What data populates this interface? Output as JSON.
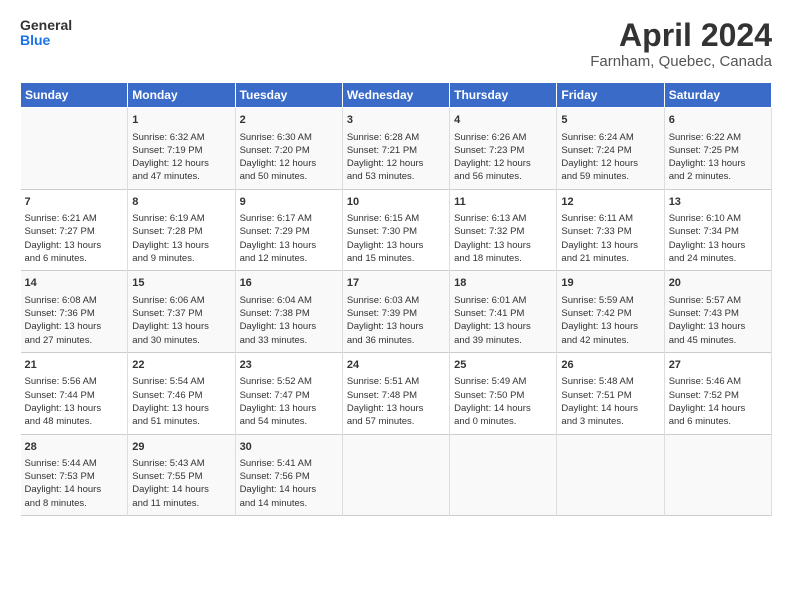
{
  "header": {
    "logo_line1": "General",
    "logo_line2": "Blue",
    "title": "April 2024",
    "subtitle": "Farnham, Quebec, Canada"
  },
  "days_of_week": [
    "Sunday",
    "Monday",
    "Tuesday",
    "Wednesday",
    "Thursday",
    "Friday",
    "Saturday"
  ],
  "weeks": [
    [
      {
        "day": "",
        "content": ""
      },
      {
        "day": "1",
        "content": "Sunrise: 6:32 AM\nSunset: 7:19 PM\nDaylight: 12 hours\nand 47 minutes."
      },
      {
        "day": "2",
        "content": "Sunrise: 6:30 AM\nSunset: 7:20 PM\nDaylight: 12 hours\nand 50 minutes."
      },
      {
        "day": "3",
        "content": "Sunrise: 6:28 AM\nSunset: 7:21 PM\nDaylight: 12 hours\nand 53 minutes."
      },
      {
        "day": "4",
        "content": "Sunrise: 6:26 AM\nSunset: 7:23 PM\nDaylight: 12 hours\nand 56 minutes."
      },
      {
        "day": "5",
        "content": "Sunrise: 6:24 AM\nSunset: 7:24 PM\nDaylight: 12 hours\nand 59 minutes."
      },
      {
        "day": "6",
        "content": "Sunrise: 6:22 AM\nSunset: 7:25 PM\nDaylight: 13 hours\nand 2 minutes."
      }
    ],
    [
      {
        "day": "7",
        "content": "Sunrise: 6:21 AM\nSunset: 7:27 PM\nDaylight: 13 hours\nand 6 minutes."
      },
      {
        "day": "8",
        "content": "Sunrise: 6:19 AM\nSunset: 7:28 PM\nDaylight: 13 hours\nand 9 minutes."
      },
      {
        "day": "9",
        "content": "Sunrise: 6:17 AM\nSunset: 7:29 PM\nDaylight: 13 hours\nand 12 minutes."
      },
      {
        "day": "10",
        "content": "Sunrise: 6:15 AM\nSunset: 7:30 PM\nDaylight: 13 hours\nand 15 minutes."
      },
      {
        "day": "11",
        "content": "Sunrise: 6:13 AM\nSunset: 7:32 PM\nDaylight: 13 hours\nand 18 minutes."
      },
      {
        "day": "12",
        "content": "Sunrise: 6:11 AM\nSunset: 7:33 PM\nDaylight: 13 hours\nand 21 minutes."
      },
      {
        "day": "13",
        "content": "Sunrise: 6:10 AM\nSunset: 7:34 PM\nDaylight: 13 hours\nand 24 minutes."
      }
    ],
    [
      {
        "day": "14",
        "content": "Sunrise: 6:08 AM\nSunset: 7:36 PM\nDaylight: 13 hours\nand 27 minutes."
      },
      {
        "day": "15",
        "content": "Sunrise: 6:06 AM\nSunset: 7:37 PM\nDaylight: 13 hours\nand 30 minutes."
      },
      {
        "day": "16",
        "content": "Sunrise: 6:04 AM\nSunset: 7:38 PM\nDaylight: 13 hours\nand 33 minutes."
      },
      {
        "day": "17",
        "content": "Sunrise: 6:03 AM\nSunset: 7:39 PM\nDaylight: 13 hours\nand 36 minutes."
      },
      {
        "day": "18",
        "content": "Sunrise: 6:01 AM\nSunset: 7:41 PM\nDaylight: 13 hours\nand 39 minutes."
      },
      {
        "day": "19",
        "content": "Sunrise: 5:59 AM\nSunset: 7:42 PM\nDaylight: 13 hours\nand 42 minutes."
      },
      {
        "day": "20",
        "content": "Sunrise: 5:57 AM\nSunset: 7:43 PM\nDaylight: 13 hours\nand 45 minutes."
      }
    ],
    [
      {
        "day": "21",
        "content": "Sunrise: 5:56 AM\nSunset: 7:44 PM\nDaylight: 13 hours\nand 48 minutes."
      },
      {
        "day": "22",
        "content": "Sunrise: 5:54 AM\nSunset: 7:46 PM\nDaylight: 13 hours\nand 51 minutes."
      },
      {
        "day": "23",
        "content": "Sunrise: 5:52 AM\nSunset: 7:47 PM\nDaylight: 13 hours\nand 54 minutes."
      },
      {
        "day": "24",
        "content": "Sunrise: 5:51 AM\nSunset: 7:48 PM\nDaylight: 13 hours\nand 57 minutes."
      },
      {
        "day": "25",
        "content": "Sunrise: 5:49 AM\nSunset: 7:50 PM\nDaylight: 14 hours\nand 0 minutes."
      },
      {
        "day": "26",
        "content": "Sunrise: 5:48 AM\nSunset: 7:51 PM\nDaylight: 14 hours\nand 3 minutes."
      },
      {
        "day": "27",
        "content": "Sunrise: 5:46 AM\nSunset: 7:52 PM\nDaylight: 14 hours\nand 6 minutes."
      }
    ],
    [
      {
        "day": "28",
        "content": "Sunrise: 5:44 AM\nSunset: 7:53 PM\nDaylight: 14 hours\nand 8 minutes."
      },
      {
        "day": "29",
        "content": "Sunrise: 5:43 AM\nSunset: 7:55 PM\nDaylight: 14 hours\nand 11 minutes."
      },
      {
        "day": "30",
        "content": "Sunrise: 5:41 AM\nSunset: 7:56 PM\nDaylight: 14 hours\nand 14 minutes."
      },
      {
        "day": "",
        "content": ""
      },
      {
        "day": "",
        "content": ""
      },
      {
        "day": "",
        "content": ""
      },
      {
        "day": "",
        "content": ""
      }
    ]
  ]
}
